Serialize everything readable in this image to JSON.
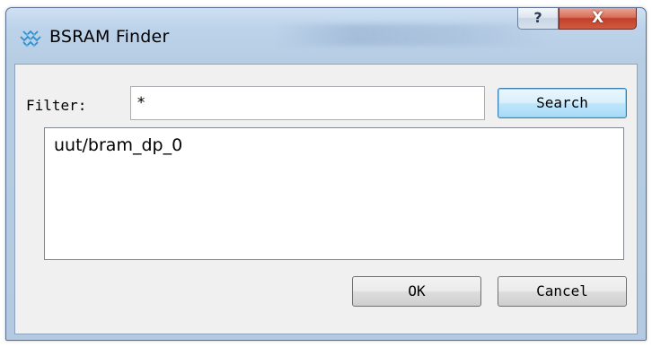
{
  "window": {
    "title": "BSRAM Finder",
    "help_glyph": "?",
    "close_glyph": "X",
    "app_icon": "bsram-finder-app-icon"
  },
  "filter": {
    "label": "Filter:",
    "value": "*",
    "search_label": "Search"
  },
  "results": {
    "items": [
      "uut/bram_dp_0"
    ]
  },
  "footer": {
    "ok_label": "OK",
    "cancel_label": "Cancel"
  },
  "colors": {
    "title_bar": "#bcd3ea",
    "client_bg": "#f0f0f0",
    "close_button": "#c2402a",
    "default_button_border": "#3c7fb1",
    "app_icon_primary": "#2f8ed0"
  }
}
